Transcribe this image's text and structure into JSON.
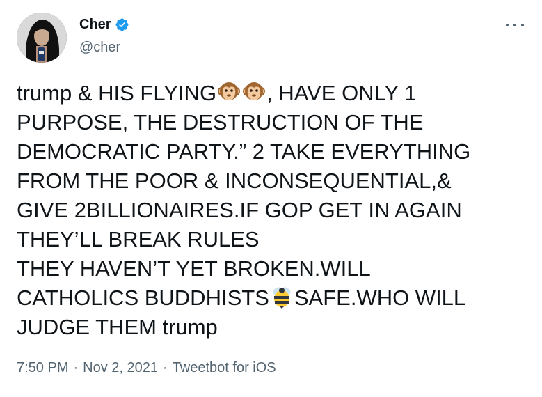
{
  "author": {
    "name": "Cher",
    "handle": "@cher",
    "verified": true
  },
  "tweet": {
    "lines": [
      [
        "trump & HIS FLYING",
        "{monkey}",
        "{monkey}",
        ", HAVE ONLY 1"
      ],
      [
        "PURPOSE, THE DESTRUCTION OF THE"
      ],
      [
        "DEMOCRATIC PARTY.” 2 TAKE EVERYTHING"
      ],
      [
        "FROM THE POOR & INCONSEQUENTIAL,&"
      ],
      [
        "GIVE 2BILLIONAIRES.IF GOP GET IN AGAIN"
      ],
      [
        "THEY’LL BREAK RULES"
      ],
      [
        "THEY HAVEN’T YET BROKEN.WILL"
      ],
      [
        "CATHOLICS BUDDHISTS",
        "{bee}",
        "SAFE.WHO WILL"
      ],
      [
        "JUDGE THEM trump"
      ]
    ],
    "emoji": {
      "monkey": "monkey-face-emoji",
      "bee": "honeybee-emoji"
    }
  },
  "meta": {
    "time": "7:50 PM",
    "separator": "·",
    "date": "Nov 2, 2021",
    "source": "Tweetbot for iOS"
  },
  "colors": {
    "text": "#0f1419",
    "secondary": "#536471",
    "verified": "#1d9bf0"
  },
  "icons": {
    "verified": "verified-badge-icon",
    "more": "more-options-icon"
  }
}
